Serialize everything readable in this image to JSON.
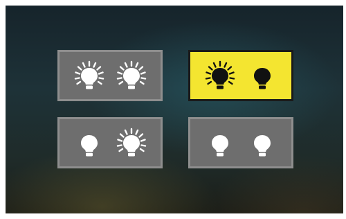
{
  "colors": {
    "tile_background": "#6e6e6e",
    "tile_border": "#8e8e8e",
    "selected_background": "#f4e530",
    "selected_border": "#1a1a1a",
    "bulb_on_light_tile": "#ffffff",
    "bulb_on_selected_tile": "#111111"
  },
  "options": [
    {
      "selected": false,
      "bulbs": [
        {
          "icon": "lightbulb-on-icon",
          "state": "on"
        },
        {
          "icon": "lightbulb-on-icon",
          "state": "on"
        }
      ]
    },
    {
      "selected": true,
      "bulbs": [
        {
          "icon": "lightbulb-on-icon",
          "state": "on"
        },
        {
          "icon": "lightbulb-off-icon",
          "state": "off"
        }
      ]
    },
    {
      "selected": false,
      "bulbs": [
        {
          "icon": "lightbulb-off-icon",
          "state": "off"
        },
        {
          "icon": "lightbulb-on-icon",
          "state": "on"
        }
      ]
    },
    {
      "selected": false,
      "bulbs": [
        {
          "icon": "lightbulb-off-icon",
          "state": "off"
        },
        {
          "icon": "lightbulb-off-icon",
          "state": "off"
        }
      ]
    }
  ]
}
